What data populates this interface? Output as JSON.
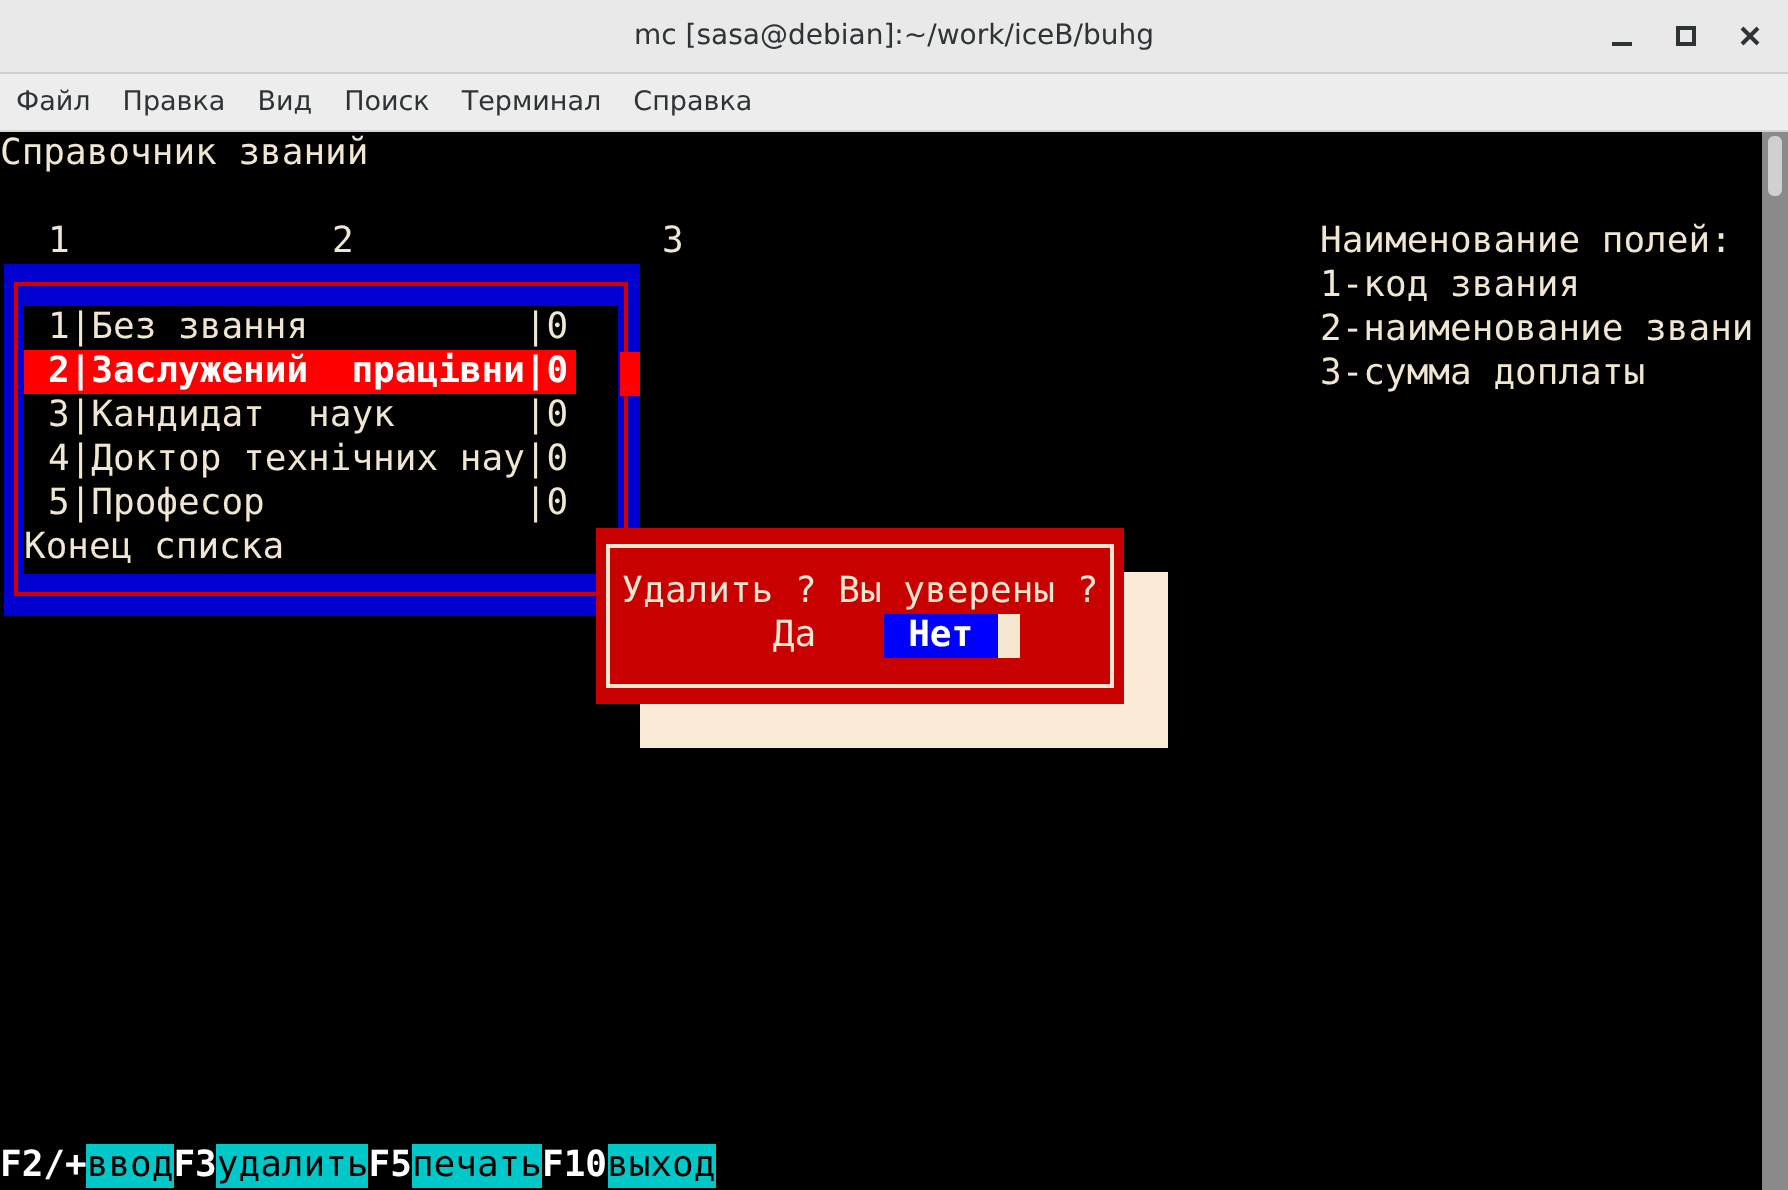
{
  "window": {
    "title": "mc [sasa@debian]:~/work/iceB/buhg"
  },
  "menu": [
    "Файл",
    "Правка",
    "Вид",
    "Поиск",
    "Терминал",
    "Справка"
  ],
  "terminal": {
    "heading": "Справочник званий",
    "column_numbers": [
      "1",
      "2",
      "3"
    ],
    "legend": {
      "title": "Наименование полей:",
      "lines": [
        "1-код звания",
        "2-наименование звани",
        "3-сумма доплаты"
      ]
    },
    "list": {
      "rows": [
        {
          "text": "1|Без звання          |0",
          "selected": false
        },
        {
          "text": "2|Заслужений  працівни|0",
          "selected": true
        },
        {
          "text": "3|Кандидат  наук      |0",
          "selected": false
        },
        {
          "text": "4|Доктор технічних нау|0",
          "selected": false
        },
        {
          "text": "5|Професор            |0",
          "selected": false
        }
      ],
      "footer": "Конец списка"
    },
    "dialog": {
      "message": "Удалить ? Вы уверены ?",
      "buttons": [
        {
          "label": "Да",
          "selected": false
        },
        {
          "label": "Нет",
          "selected": true
        }
      ]
    },
    "function_keys": [
      {
        "key": "F2/+",
        "label": "ввод"
      },
      {
        "key": "F3",
        "label": "удалить"
      },
      {
        "key": "F5",
        "label": "печать"
      },
      {
        "key": "F10",
        "label": "выход"
      }
    ]
  }
}
